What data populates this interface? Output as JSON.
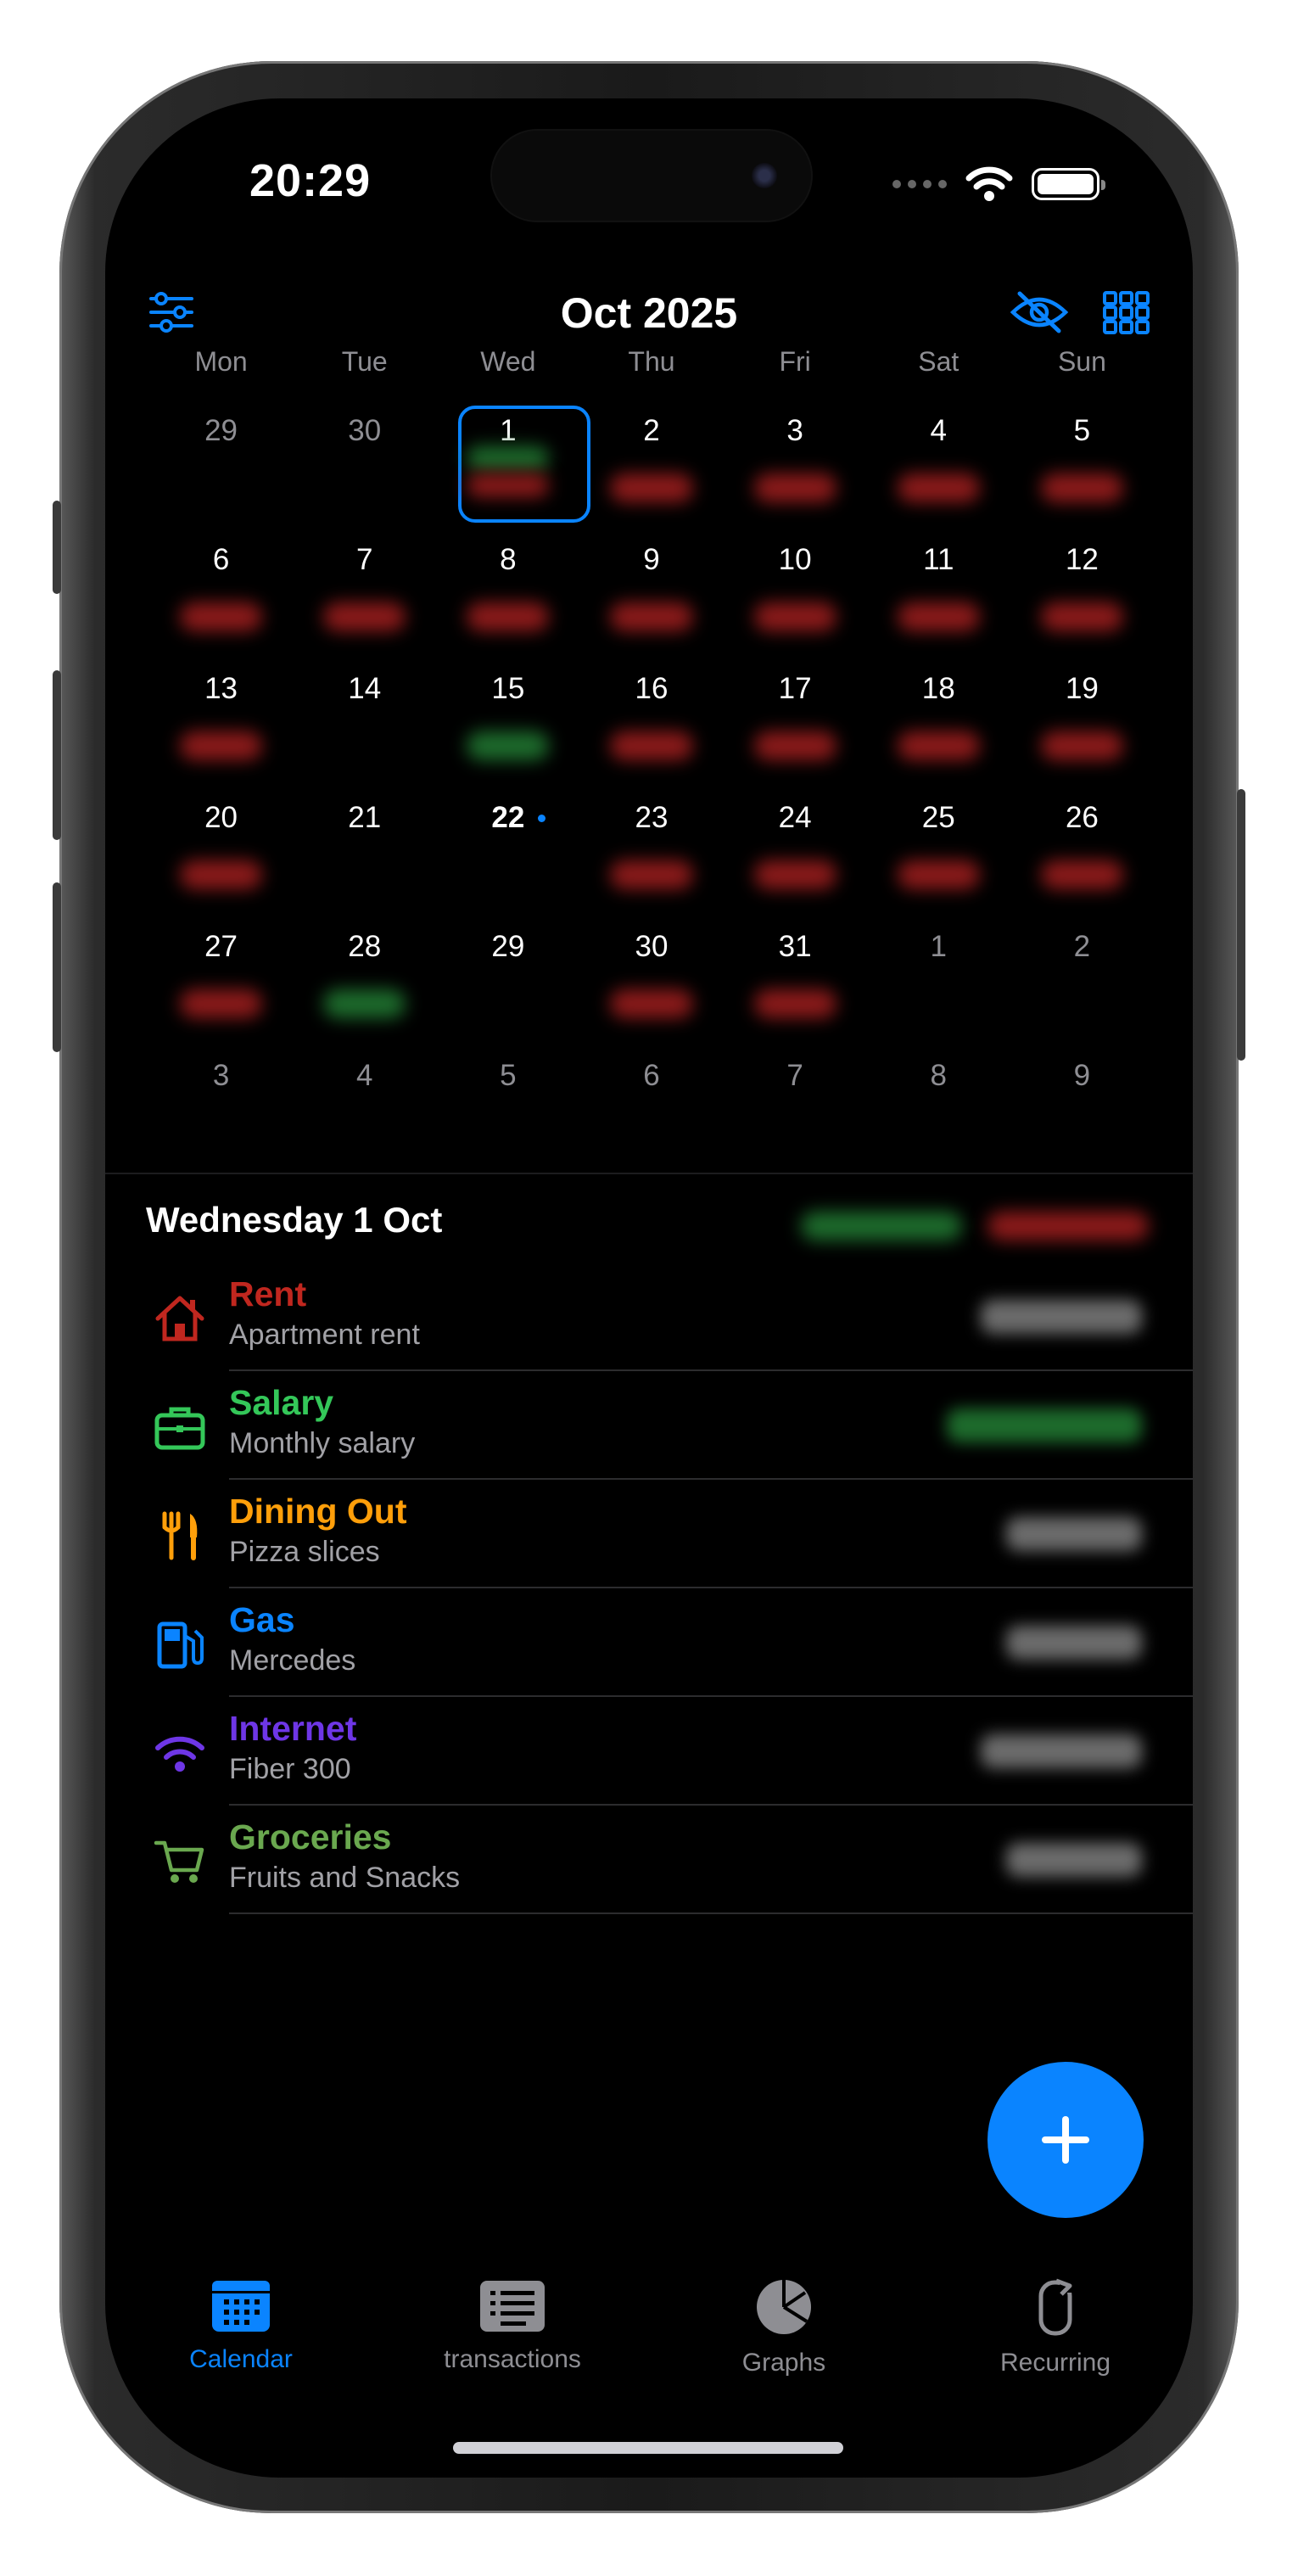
{
  "status_bar": {
    "time": "20:29"
  },
  "header": {
    "title": "Oct 2025",
    "left_icon": "sliders-icon",
    "right_icons": [
      "eye-slash-icon",
      "grid-icon"
    ]
  },
  "weekdays": [
    "Mon",
    "Tue",
    "Wed",
    "Thu",
    "Fri",
    "Sat",
    "Sun"
  ],
  "calendar": {
    "days": [
      "29",
      "30",
      "1",
      "2",
      "3",
      "4",
      "5",
      "6",
      "7",
      "8",
      "9",
      "10",
      "11",
      "12",
      "13",
      "14",
      "15",
      "16",
      "17",
      "18",
      "19",
      "20",
      "21",
      "22",
      "23",
      "24",
      "25",
      "26",
      "27",
      "28",
      "29",
      "30",
      "31",
      "1",
      "2",
      "3",
      "4",
      "5",
      "6",
      "7",
      "8",
      "9"
    ]
  },
  "selected_day": {
    "title": "Wednesday 1 Oct",
    "transactions": [
      {
        "name": "Rent",
        "note": "Apartment rent",
        "icon": "house-icon",
        "color": "#c0271f"
      },
      {
        "name": "Salary",
        "note": "Monthly salary",
        "icon": "briefcase-icon",
        "color": "#34c759"
      },
      {
        "name": "Dining Out",
        "note": "Pizza slices",
        "icon": "fork-knife-icon",
        "color": "#ff9f0a"
      },
      {
        "name": "Gas",
        "note": "Mercedes",
        "icon": "fuel-pump-icon",
        "color": "#0a84ff"
      },
      {
        "name": "Internet",
        "note": "Fiber 300",
        "icon": "wifi-icon",
        "color": "#6e36e6"
      },
      {
        "name": "Groceries",
        "note": "Fruits and Snacks",
        "icon": "cart-icon",
        "color": "#6aa84f"
      }
    ]
  },
  "tabs": [
    {
      "label": "Calendar",
      "icon": "calendar-icon"
    },
    {
      "label": "transactions",
      "icon": "list-icon"
    },
    {
      "label": "Graphs",
      "icon": "pie-chart-icon"
    },
    {
      "label": "Recurring",
      "icon": "recurring-icon"
    }
  ],
  "colors": {
    "accent": "#0a84ff",
    "expense": "#8b1a1a",
    "income": "#1d6b2c"
  }
}
